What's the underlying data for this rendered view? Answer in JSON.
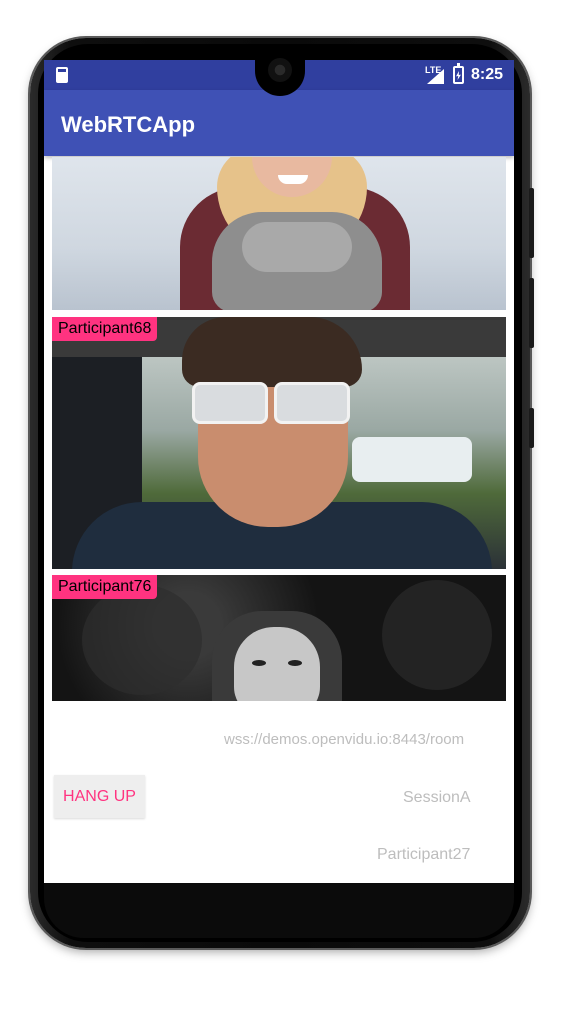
{
  "status_bar": {
    "network_label": "LTE",
    "time": "8:25",
    "icons": [
      "sim-card-icon",
      "signal-icon",
      "battery-icon"
    ]
  },
  "app_bar": {
    "title": "WebRTCApp"
  },
  "videos": [
    {
      "participant": ""
    },
    {
      "participant": "Participant68"
    },
    {
      "participant": "Participant76"
    }
  ],
  "session": {
    "server_url": "wss://demos.openvidu.io:8443/room",
    "session_name": "SessionA",
    "participant_name": "Participant27",
    "hangup_label": "HANG UP"
  },
  "colors": {
    "status_bar": "#303f9f",
    "app_bar": "#3f51b5",
    "accent": "#ff3380",
    "hint_text": "#bdbdbd",
    "button_bg": "#eeeeee"
  }
}
